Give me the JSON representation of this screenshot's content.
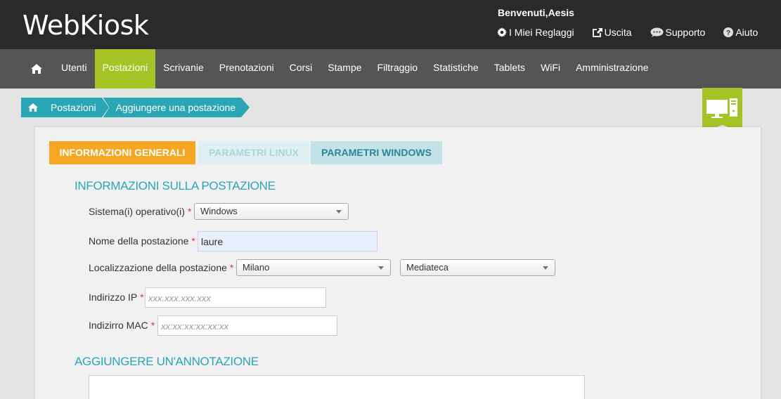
{
  "header": {
    "logo": "WebKiosk",
    "welcome": "Benvenuti,Aesis",
    "links": {
      "settings": "I Miei Reglaggi",
      "exit": "Uscita",
      "support": "Supporto",
      "help": "Aiuto"
    }
  },
  "nav": {
    "items": [
      "Utenti",
      "Postazioni",
      "Scrivanie",
      "Prenotazioni",
      "Corsi",
      "Stampe",
      "Filtraggio",
      "Statistiche",
      "Tablets",
      "WiFi",
      "Amministrazione"
    ],
    "active": "Postazioni"
  },
  "breadcrumb": {
    "parent": "Postazioni",
    "current": "Aggiungere una postazione"
  },
  "tabs": {
    "general": "INFORMAZIONI GENERALI",
    "linux": "PARAMETRI LINUX",
    "windows": "PARAMETRI WINDOWS"
  },
  "form": {
    "section_title": "INFORMAZIONI SULLA POSTAZIONE",
    "os_label": "Sistema(i) operativo(i)",
    "os_value": "Windows",
    "name_label": "Nome della postazione",
    "name_value": "laure",
    "location_label": "Localizzazione della postazione",
    "location_city": "Milano",
    "location_place": "Mediateca",
    "ip_label": "Indirizzo IP",
    "ip_placeholder": "xxx.xxx.xxx.xxx",
    "mac_label": "Indizirro MAC",
    "mac_placeholder": "xx:xx:xx:xx:xx:xx",
    "required_mark": "*"
  },
  "annotation": {
    "section_title": "AGGIUNGERE UN'ANNOTAZIONE"
  },
  "colors": {
    "accent_green": "#a5c325",
    "accent_teal": "#2aa5b5",
    "tab_orange": "#f5a623",
    "header_dark": "#2a2a2a",
    "nav_gray": "#555555"
  }
}
